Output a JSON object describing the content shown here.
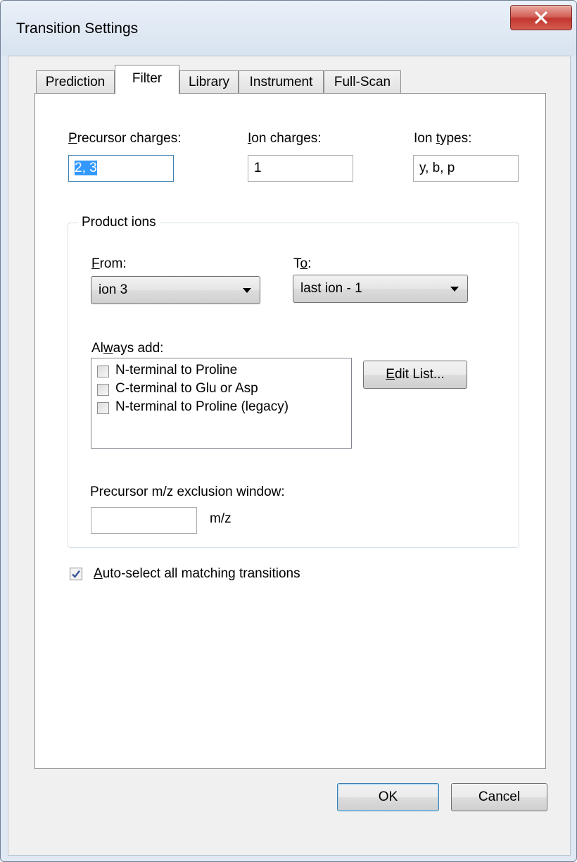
{
  "window": {
    "title": "Transition Settings"
  },
  "tabs": [
    {
      "label": "Prediction"
    },
    {
      "label": "Filter"
    },
    {
      "label": "Library"
    },
    {
      "label": "Instrument"
    },
    {
      "label": "Full-Scan"
    }
  ],
  "filter": {
    "precursor_charges": {
      "label_u": "P",
      "label_rest": "recursor charges:",
      "value": "2, 3"
    },
    "ion_charges": {
      "label_u": "I",
      "label_rest": "on charges:",
      "value": "1"
    },
    "ion_types": {
      "label_pre": "Ion ",
      "label_u": "t",
      "label_rest": "ypes:",
      "value": "y, b, p"
    },
    "product_ions": {
      "title": "Product ions",
      "from": {
        "label_u": "F",
        "label_rest": "rom:",
        "value": "ion 3"
      },
      "to": {
        "label_pre": "T",
        "label_u": "o",
        "label_rest": ":",
        "value": "last ion - 1"
      },
      "always_add": {
        "label_pre": "Al",
        "label_u": "w",
        "label_rest": "ays add:",
        "items": [
          {
            "label": "N-terminal to Proline",
            "checked": false
          },
          {
            "label": "C-terminal to Glu or Asp",
            "checked": false
          },
          {
            "label": "N-terminal to Proline (legacy)",
            "checked": false
          }
        ]
      },
      "edit_list": {
        "label_u": "E",
        "label_rest": "dit List..."
      },
      "exclusion": {
        "label": "Precursor m/z exclusion window:",
        "value": "",
        "unit": "m/z"
      }
    },
    "auto_select": {
      "label_u": "A",
      "label_rest": "uto-select all matching transitions",
      "checked": true
    }
  },
  "buttons": {
    "ok": "OK",
    "cancel": "Cancel"
  }
}
